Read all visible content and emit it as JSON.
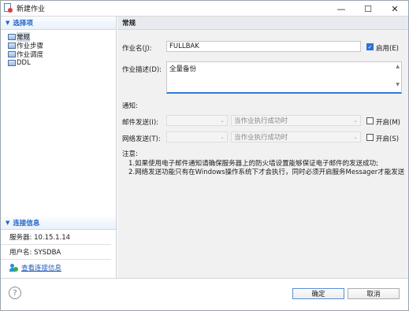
{
  "window": {
    "title": "新建作业",
    "minimize_glyph": "—",
    "maximize_glyph": "☐",
    "close_glyph": "✕"
  },
  "sidebar": {
    "section_title": "选择项",
    "items": [
      {
        "label": "常规",
        "icon": "table-icon",
        "selected": true
      },
      {
        "label": "作业步骤",
        "icon": "table-icon",
        "selected": false
      },
      {
        "label": "作业调度",
        "icon": "table-icon",
        "selected": false
      },
      {
        "label": "DDL",
        "icon": "table-icon",
        "selected": false
      }
    ],
    "connection": {
      "section_title": "连接信息",
      "server_text": "服务器: 10.15.1.14",
      "user_text": "用户名: SYSDBA",
      "link_label": "查看连接信息",
      "link_icon": "user-connection-icon"
    }
  },
  "main": {
    "header": "常规",
    "job_name_label": "作业名(J):",
    "job_name_value": "FULLBAK",
    "enable_label": "启用(E)",
    "enable_checked": true,
    "desc_label": "作业描述(D):",
    "desc_value": "全量备份",
    "notify_label": "通知:",
    "mail_label": "邮件发送(I):",
    "mail_condition": "当作业执行成功时",
    "mail_on_label": "开启(M)",
    "mail_on_checked": false,
    "net_label": "网络发送(T):",
    "net_condition": "当作业执行成功时",
    "net_on_label": "开启(S)",
    "net_on_checked": false,
    "note_title": "注意:",
    "note_1": "1.如果使用电子邮件通知请确保服务器上的防火墙设置能够保证电子邮件的发送成功;",
    "note_2": "2.网络发送功能只有在Windows操作系统下才会执行，同时必须开启服务Messager才能发送"
  },
  "footer": {
    "help_glyph": "?",
    "ok_label": "确定",
    "cancel_label": "取消"
  },
  "colors": {
    "accent": "#1e64c8",
    "checkbox_checked": "#2f6fd6",
    "focus_underline": "#2f7bd6"
  }
}
